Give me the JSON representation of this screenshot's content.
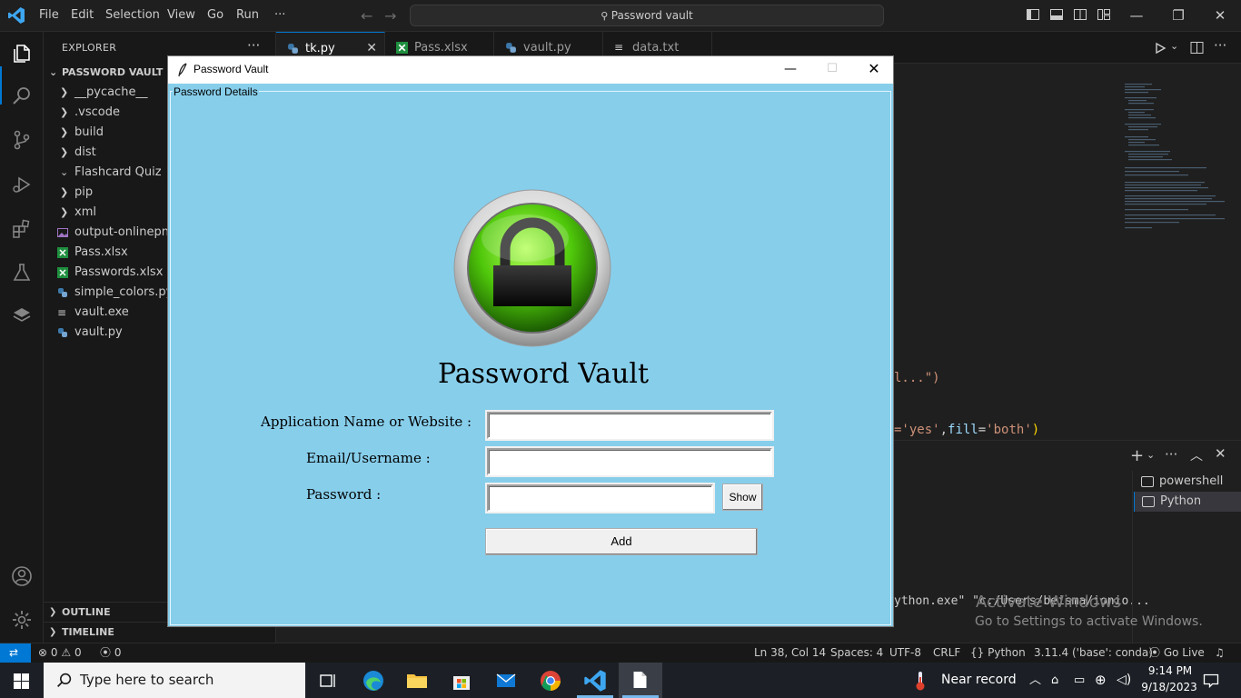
{
  "vscode": {
    "menu": [
      "File",
      "Edit",
      "Selection",
      "View",
      "Go",
      "Run",
      "···"
    ],
    "command_center": "Password vault",
    "explorer_title": "EXPLORER",
    "explorer_more": "···",
    "project_root": "PASSWORD VAULT",
    "tree": [
      {
        "label": "__pycache__",
        "kind": "folder",
        "open": false
      },
      {
        "label": ".vscode",
        "kind": "folder",
        "open": false
      },
      {
        "label": "build",
        "kind": "folder",
        "open": false
      },
      {
        "label": "dist",
        "kind": "folder",
        "open": false
      },
      {
        "label": "Flashcard Quiz",
        "kind": "folder",
        "open": true
      },
      {
        "label": "pip",
        "kind": "folder",
        "open": false
      },
      {
        "label": "xml",
        "kind": "folder",
        "open": false
      },
      {
        "label": "output-onlinepng",
        "kind": "image"
      },
      {
        "label": "Pass.xlsx",
        "kind": "excel"
      },
      {
        "label": "Passwords.xlsx",
        "kind": "excel"
      },
      {
        "label": "simple_colors.py",
        "kind": "python"
      },
      {
        "label": "vault.exe",
        "kind": "exe"
      },
      {
        "label": "vault.py",
        "kind": "python"
      }
    ],
    "outline": "OUTLINE",
    "timeline": "TIMELINE",
    "tabs": [
      {
        "label": "tk.py",
        "icon": "python-icon",
        "close": "✕"
      },
      {
        "label": "Pass.xlsx",
        "icon": "excel-icon"
      },
      {
        "label": "vault.py",
        "icon": "python-icon"
      },
      {
        "label": "data.txt",
        "icon": "text-file-icon"
      }
    ],
    "code_fragments": {
      "line1": "l...\")",
      "line2_a": "='yes'",
      "line2_b": ",",
      "line2_c": "fill",
      "line2_d": "=",
      "line2_e": "'both'",
      "line2_f": ")",
      "terminal_line": "ython.exe\" \"c:/Users/beisma/ionio..."
    },
    "terminals": [
      "powershell",
      "Python"
    ],
    "activate_windows": "Activate Windows",
    "activate_sub": "Go to Settings to activate Windows.",
    "status": {
      "errors": "0",
      "warnings": "0",
      "ports": "0",
      "position": "Ln 38, Col 14",
      "spaces": "Spaces: 4",
      "encoding": "UTF-8",
      "eol": "CRLF",
      "language": "Python",
      "interpreter": "3.11.4 ('base': conda)",
      "golive": "Go Live"
    }
  },
  "tk_window": {
    "title": "Password Vault",
    "frame_label": "Password Details",
    "heading": "Password Vault",
    "fields": {
      "app_label": "Application Name or Website :",
      "app_value": "",
      "email_label": "Email/Username :",
      "email_value": "",
      "password_label": "Password :",
      "password_value": ""
    },
    "show_button": "Show",
    "add_button": "Add",
    "colors": {
      "background": "#87ceeb",
      "lock_green": "#4fc70a",
      "lock_body": "#111111"
    }
  },
  "taskbar": {
    "search_placeholder": "Type here to search",
    "weather": "Near record",
    "time": "9:14 PM",
    "date": "9/18/2023"
  }
}
